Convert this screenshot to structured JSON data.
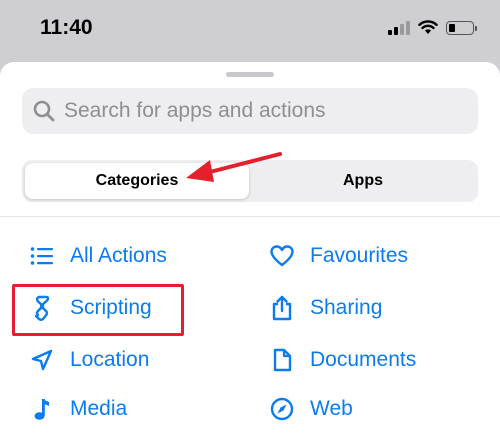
{
  "status_bar": {
    "time": "11:40",
    "icons": [
      "cellular-signal-icon",
      "wifi-icon",
      "battery-icon"
    ]
  },
  "sheet": {
    "search": {
      "placeholder": "Search for apps and actions",
      "icon": "search-icon"
    },
    "segmented_control": {
      "segments": [
        {
          "label": "Categories",
          "selected": true
        },
        {
          "label": "Apps",
          "selected": false
        }
      ]
    },
    "categories_left": [
      {
        "label": "All Actions",
        "icon": "list-icon"
      },
      {
        "label": "Scripting",
        "icon": "scripting-icon"
      },
      {
        "label": "Location",
        "icon": "location-arrow-icon"
      },
      {
        "label": "Media",
        "icon": "music-note-icon"
      }
    ],
    "categories_right": [
      {
        "label": "Favourites",
        "icon": "heart-icon"
      },
      {
        "label": "Sharing",
        "icon": "share-icon"
      },
      {
        "label": "Documents",
        "icon": "document-icon"
      },
      {
        "label": "Web",
        "icon": "compass-icon"
      }
    ]
  },
  "annotations": {
    "arrow_color": "#e5202d",
    "highlight_color": "#e5202d",
    "highlighted_item": "Scripting",
    "arrow_points_to": "Categories"
  },
  "colors": {
    "accent": "#0a7cf0",
    "background": "#cfcfd1",
    "sheet": "#ffffff"
  }
}
